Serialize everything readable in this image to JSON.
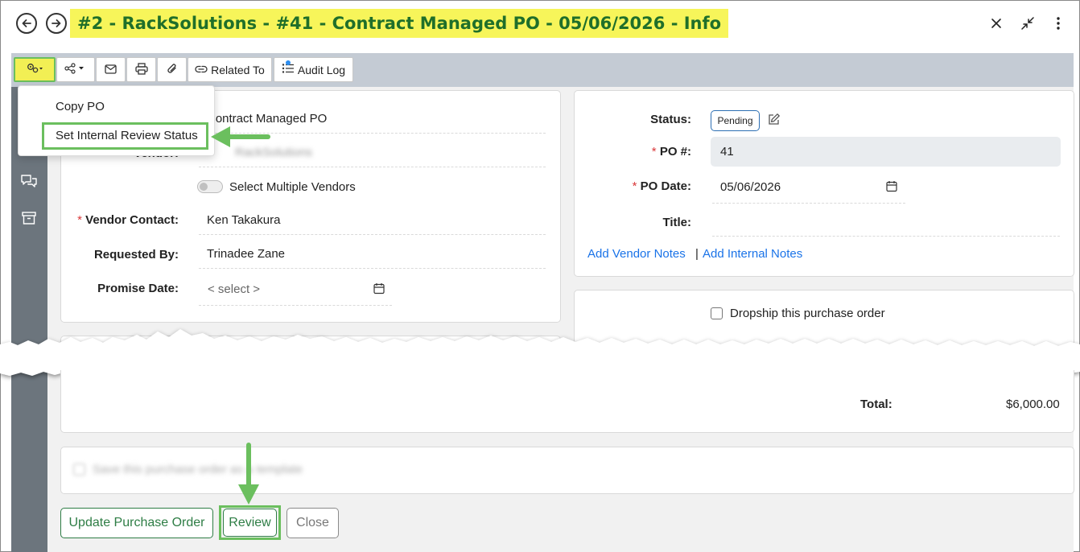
{
  "header": {
    "title": "#2 - RackSolutions - #41 - Contract Managed PO - 05/06/2026 - Info",
    "icons": [
      "back-circle-icon",
      "forward-circle-icon",
      "close-icon",
      "minimize-icon",
      "more-vertical-icon"
    ]
  },
  "toolbar": {
    "buttons": [
      {
        "name": "actions",
        "icon": "gears-icon",
        "caret": true
      },
      {
        "name": "share",
        "icon": "share-icon",
        "caret": true
      },
      {
        "name": "email",
        "icon": "envelope-icon"
      },
      {
        "name": "print",
        "icon": "printer-icon"
      },
      {
        "name": "attach",
        "icon": "paperclip-icon"
      },
      {
        "name": "related",
        "icon": "link-icon",
        "label": "Related To"
      },
      {
        "name": "audit",
        "icon": "list-icon",
        "label": "Audit Log",
        "notification_dot": true
      }
    ],
    "related_label": "Related To",
    "audit_label": "Audit Log"
  },
  "dropdown": {
    "items": [
      "Copy PO",
      "Set Internal Review Status"
    ],
    "highlighted_index": 1
  },
  "left_form": {
    "po_type": "Contract Managed PO",
    "vendor_label": "Vendor:",
    "vendor_value": "RackSolutions",
    "multiple_vendors_label": "Select Multiple Vendors",
    "vendor_contact_label": "Vendor Contact:",
    "vendor_contact_value": "Ken Takakura",
    "requested_by_label": "Requested By:",
    "requested_by_value": "Trinadee Zane",
    "promise_date_label": "Promise Date:",
    "promise_date_placeholder": "< select >"
  },
  "right_form": {
    "status_label": "Status:",
    "status_value": "Pending",
    "po_number_label": "PO #:",
    "po_number_value": "41",
    "po_date_label": "PO Date:",
    "po_date_value": "05/06/2026",
    "title_label": "Title:",
    "title_value": "",
    "add_vendor_notes": "Add Vendor Notes",
    "separator": "|",
    "add_internal_notes": "Add Internal Notes",
    "dropship_label": "Dropship this purchase order"
  },
  "totals": {
    "total_label": "Total:",
    "total_value": "$6,000.00"
  },
  "template": {
    "save_template_label": "Save this purchase order as a template"
  },
  "footer": {
    "update_label": "Update Purchase Order",
    "review_label": "Review",
    "close_label": "Close"
  },
  "colors": {
    "title_highlight": "#f7f55a",
    "title_text": "#1f6f2a",
    "annotation_green": "#6bbf5e",
    "toolbar_bg": "#c4cbd4",
    "sidebar_bg": "#6c757d",
    "link": "#1a73e8",
    "required": "#d9383a"
  }
}
